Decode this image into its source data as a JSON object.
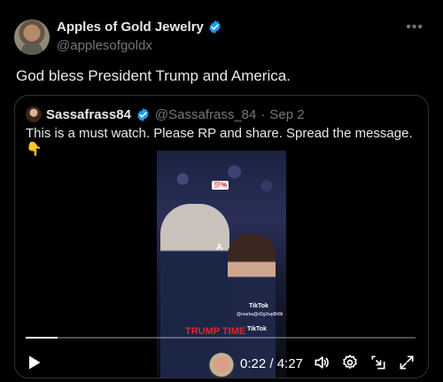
{
  "tweet": {
    "author_name": "Apples of Gold Jewelry",
    "handle": "@applesofgoldx",
    "text": "God bless President Trump and America."
  },
  "quote": {
    "author_name": "Sassafrass84",
    "handle": "@Sassafrass_84",
    "separator": "·",
    "date": "Sep 2",
    "text": "This is a must watch. Please RP and share. Spread the message. 👇"
  },
  "video": {
    "badge": "💯%",
    "letter": "A",
    "tiktok_label": "TikTok",
    "tiktok_handle": "@marka@d2g2wp8h8il",
    "overlay_text": "TRUMP TIME",
    "tiktok_label_2": "TikTok",
    "current_time": "0:22",
    "duration": "4:27",
    "time_display": "0:22 / 4:27",
    "progress_fraction": 0.082
  },
  "icons": {
    "verified": "verified-badge-icon",
    "more": "more-options-icon",
    "play": "play-icon",
    "volume": "volume-icon",
    "settings": "settings-icon",
    "pip": "picture-in-picture-icon",
    "fullscreen": "fullscreen-icon"
  },
  "colors": {
    "verified_blue": "#1d9bf0",
    "background": "#000000",
    "secondary_text": "#71767b",
    "overlay_red": "#e0252f"
  }
}
